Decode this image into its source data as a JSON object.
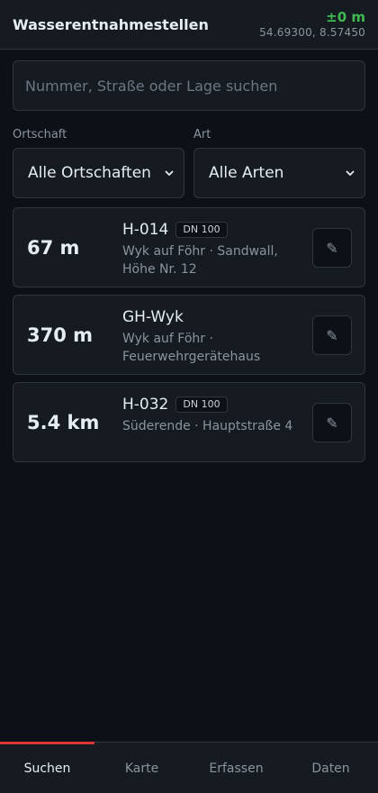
{
  "header": {
    "title": "Wasserentnahmestellen",
    "gps_accuracy": "±0 m",
    "gps_coords": "54.69300, 8.57450",
    "accuracy_color": "#3fb950"
  },
  "search": {
    "placeholder": "Nummer, Straße oder Lage suchen",
    "value": ""
  },
  "filters": {
    "ortschaft_label": "Ortschaft",
    "ortschaft_value": "Alle Ortschaften",
    "art_label": "Art",
    "art_value": "Alle Arten"
  },
  "results": [
    {
      "distance": "67 m",
      "name": "H-014",
      "badge": "DN 100",
      "location_line1": "Wyk auf Föhr · Sandwall,",
      "location_line2": "Höhe Nr. 12",
      "edit_icon": "pencil-icon"
    },
    {
      "distance": "370 m",
      "name": "GH-Wyk",
      "badge": "",
      "location_line1": "Wyk auf Föhr ·",
      "location_line2": "Feuerwehrgerätehaus",
      "edit_icon": "pencil-icon"
    },
    {
      "distance": "5.4 km",
      "name": "H-032",
      "badge": "DN 100",
      "location_line1": "Süderende · Hauptstraße 4",
      "location_line2": "",
      "edit_icon": "pencil-icon"
    }
  ],
  "nav": {
    "tabs": [
      {
        "label": "Suchen"
      },
      {
        "label": "Karte"
      },
      {
        "label": "Erfassen"
      },
      {
        "label": "Daten"
      }
    ],
    "active": "Suchen",
    "active_color": "#da3633"
  }
}
